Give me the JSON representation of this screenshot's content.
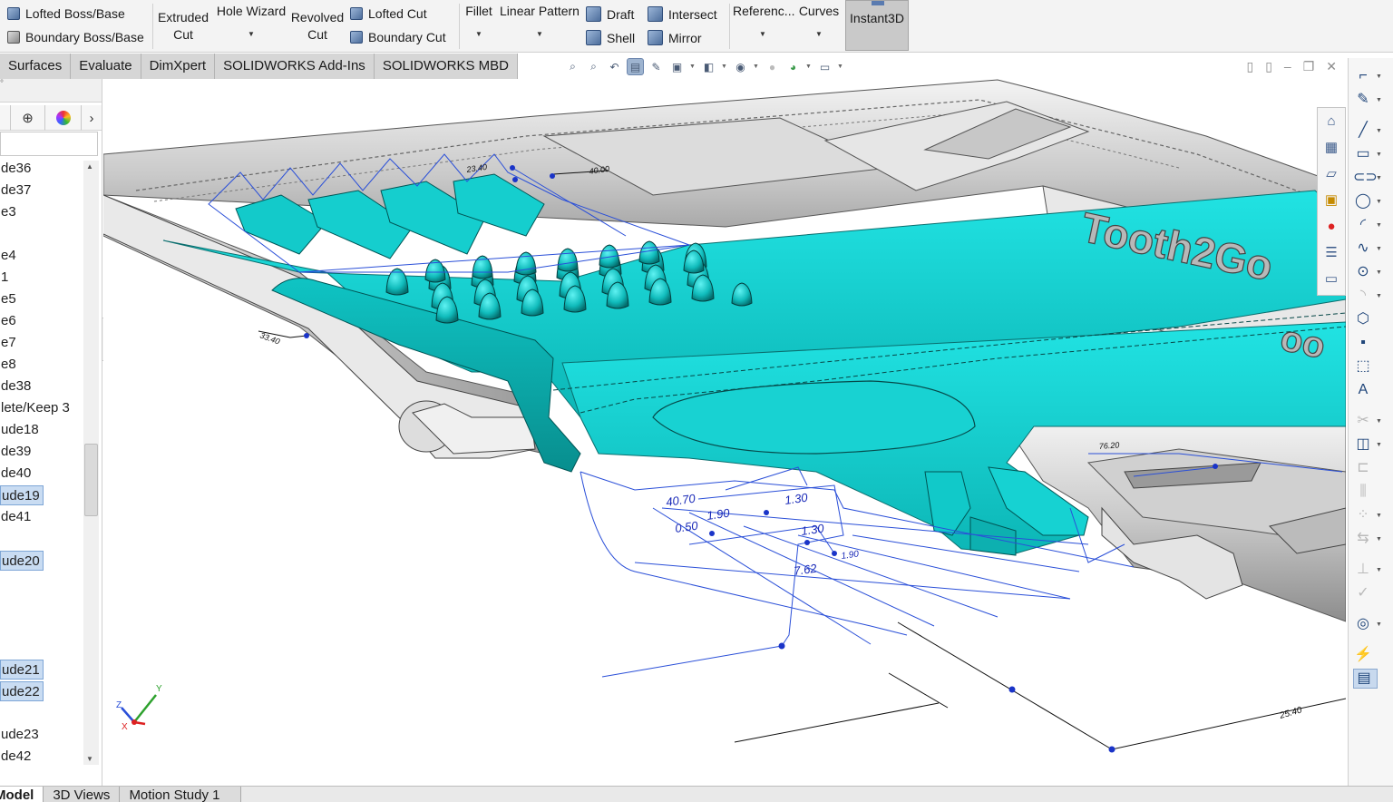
{
  "ribbon": {
    "lofted_boss": "Lofted Boss/Base",
    "boundary_boss": "Boundary Boss/Base",
    "extruded_cut": "Extruded\nCut",
    "hole_wizard": "Hole Wizard",
    "revolved_cut": "Revolved\nCut",
    "lofted_cut": "Lofted Cut",
    "boundary_cut": "Boundary Cut",
    "fillet": "Fillet",
    "linear_pattern": "Linear Pattern",
    "draft": "Draft",
    "intersect": "Intersect",
    "shell": "Shell",
    "mirror": "Mirror",
    "reference": "Referenc...",
    "curves": "Curves",
    "instant3d": "Instant3D"
  },
  "cmd_tabs": [
    "Surfaces",
    "Evaluate",
    "DimXpert",
    "SOLIDWORKS Add-Ins",
    "SOLIDWORKS MBD"
  ],
  "tree": {
    "items": [
      {
        "label": "de36",
        "selected": false
      },
      {
        "label": "de37",
        "selected": false
      },
      {
        "label": "e3",
        "selected": false
      },
      {
        "label": "",
        "selected": false
      },
      {
        "label": "e4",
        "selected": false
      },
      {
        "label": "1",
        "selected": false
      },
      {
        "label": "e5",
        "selected": false
      },
      {
        "label": "e6",
        "selected": false
      },
      {
        "label": "e7",
        "selected": false
      },
      {
        "label": "e8",
        "selected": false
      },
      {
        "label": "de38",
        "selected": false
      },
      {
        "label": "lete/Keep 3",
        "selected": false
      },
      {
        "label": "ude18",
        "selected": false
      },
      {
        "label": "de39",
        "selected": false
      },
      {
        "label": "de40",
        "selected": false
      },
      {
        "label": "ude19",
        "selected": true
      },
      {
        "label": "de41",
        "selected": false
      },
      {
        "label": "",
        "selected": false
      },
      {
        "label": "ude20",
        "selected": true
      },
      {
        "label": "",
        "selected": false
      },
      {
        "label": "",
        "selected": false
      },
      {
        "label": "",
        "selected": false
      },
      {
        "label": "",
        "selected": false
      },
      {
        "label": "ude21",
        "selected": true
      },
      {
        "label": "ude22",
        "selected": true
      },
      {
        "label": "",
        "selected": false
      },
      {
        "label": "ude23",
        "selected": false
      },
      {
        "label": "de42",
        "selected": false
      }
    ]
  },
  "model": {
    "emboss_text_1": "Tooth2Go",
    "emboss_text_2": "oo",
    "dimensions": [
      "40.70",
      "1.30",
      "1.90",
      "0.50",
      "1.30",
      "7.62",
      "1.90",
      "23.40",
      "33.40",
      "25.40",
      "76.20",
      "40.00"
    ]
  },
  "triad": {
    "x": "X",
    "y": "Y",
    "z": "Z"
  },
  "bottom_tabs": [
    "Model",
    "3D Views",
    "Motion Study 1"
  ],
  "colors": {
    "accent": "#16d6d6",
    "selection": "#c9dcf2",
    "sketch": "#1f3fd0"
  }
}
